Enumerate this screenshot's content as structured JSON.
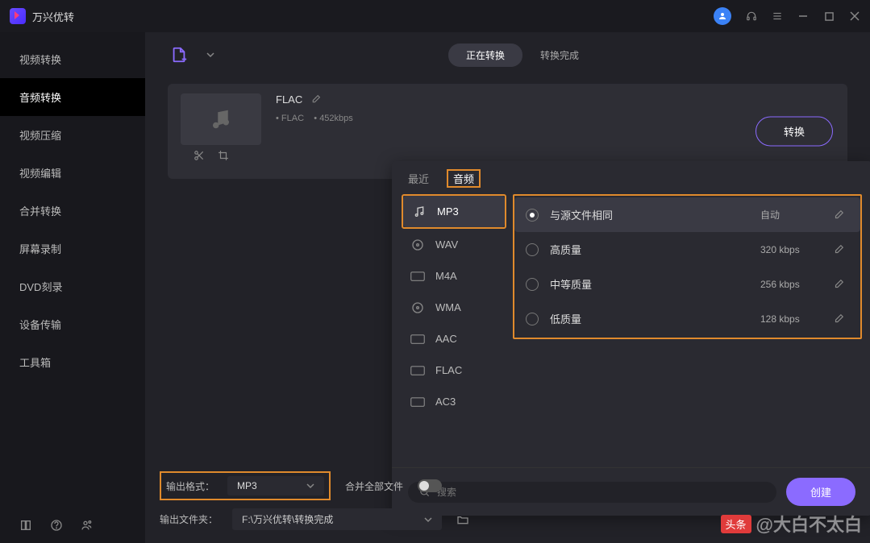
{
  "app": {
    "title": "万兴优转"
  },
  "window": {
    "avatar_icon": "user"
  },
  "sidebar": {
    "items": [
      {
        "label": "视频转换"
      },
      {
        "label": "音频转换"
      },
      {
        "label": "视频压缩"
      },
      {
        "label": "视频编辑"
      },
      {
        "label": "合并转换"
      },
      {
        "label": "屏幕录制"
      },
      {
        "label": "DVD刻录"
      },
      {
        "label": "设备传输"
      },
      {
        "label": "工具箱"
      }
    ]
  },
  "main_tabs": {
    "converting": "正在转换",
    "finished": "转换完成"
  },
  "file": {
    "name": "FLAC",
    "format": "FLAC",
    "bitrate": "452kbps",
    "convert_label": "转换"
  },
  "popup": {
    "tab_recent": "最近",
    "tab_audio": "音频",
    "formats": [
      {
        "label": "MP3"
      },
      {
        "label": "WAV"
      },
      {
        "label": "M4A"
      },
      {
        "label": "WMA"
      },
      {
        "label": "AAC"
      },
      {
        "label": "FLAC"
      },
      {
        "label": "AC3"
      }
    ],
    "qualities": [
      {
        "name": "与源文件相同",
        "rate": "自动"
      },
      {
        "name": "高质量",
        "rate": "320 kbps"
      },
      {
        "name": "中等质量",
        "rate": "256 kbps"
      },
      {
        "name": "低质量",
        "rate": "128 kbps"
      }
    ],
    "search_placeholder": "搜索",
    "create_label": "创建"
  },
  "bottom": {
    "output_format_label": "输出格式：",
    "output_format_value": "MP3",
    "merge_label": "合并全部文件",
    "output_folder_label": "输出文件夹：",
    "output_folder_value": "F:\\万兴优转\\转换完成"
  },
  "watermark": {
    "badge": "头条",
    "text": "@大白不太白"
  }
}
